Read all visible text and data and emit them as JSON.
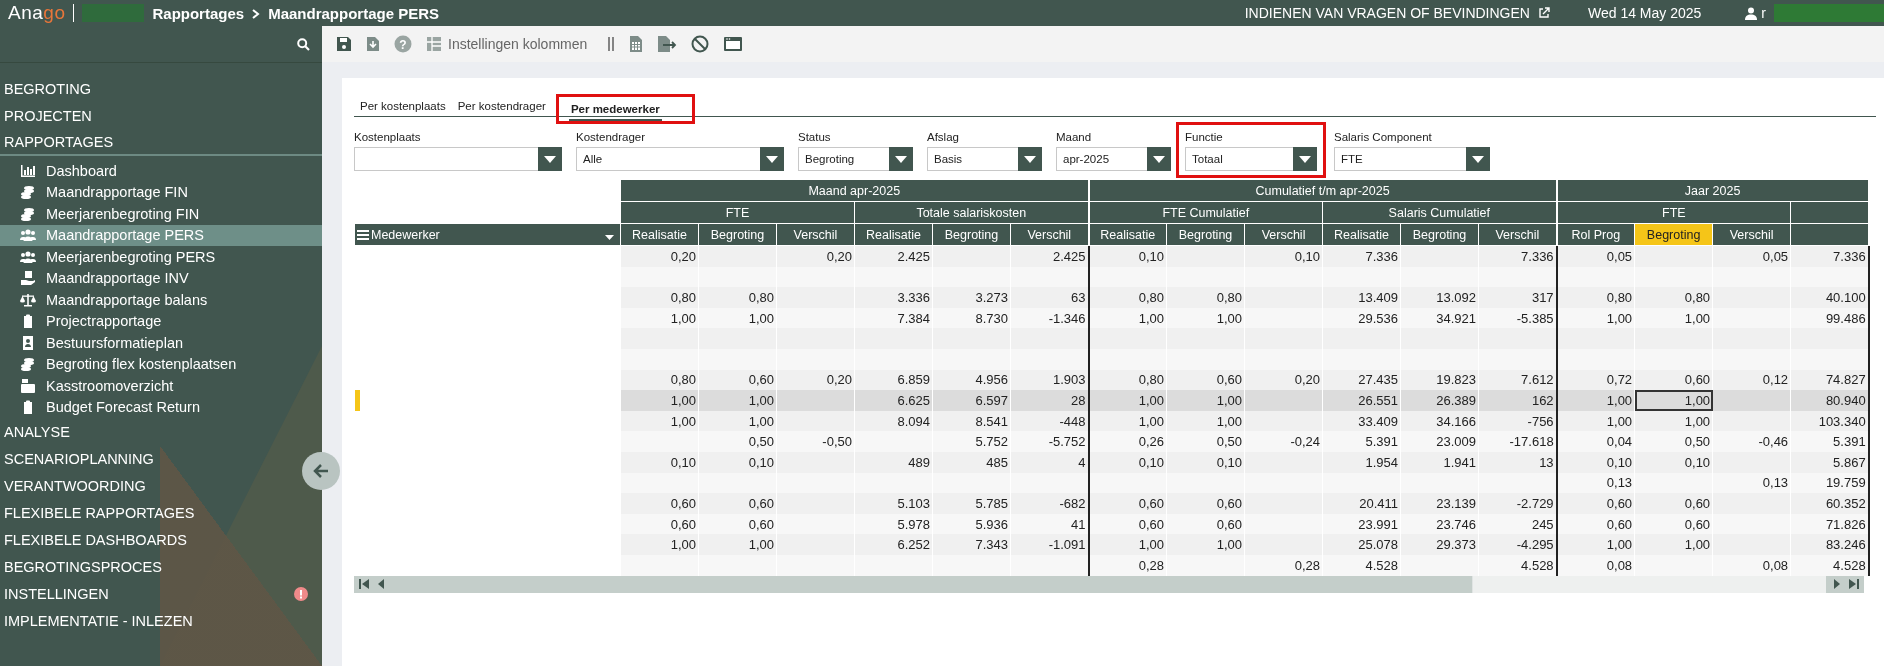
{
  "topbar": {
    "logo_main": "Ana",
    "logo_accent": "go",
    "breadcrumb": [
      "Rapportages",
      "Maandrapportage PERS"
    ],
    "feedback_link": "INDIENEN VAN VRAGEN OF BEVINDINGEN",
    "date": "Wed 14 May 2025",
    "user": "r"
  },
  "toolbar": {
    "help_label": "?",
    "columns_button": "Instellingen kolommen"
  },
  "sidebar": {
    "top_items": [
      {
        "label": "BEGROTING",
        "expanded": false
      },
      {
        "label": "PROJECTEN",
        "expanded": false
      },
      {
        "label": "RAPPORTAGES",
        "expanded": true,
        "children": [
          {
            "label": "Dashboard",
            "selected": false
          },
          {
            "label": "Maandrapportage FIN",
            "selected": false
          },
          {
            "label": "Meerjarenbegroting FIN",
            "selected": false
          },
          {
            "label": "Maandrapportage PERS",
            "selected": true
          },
          {
            "label": "Meerjarenbegroting PERS",
            "selected": false
          },
          {
            "label": "Maandrapportage INV",
            "selected": false
          },
          {
            "label": "Maandrapportage balans",
            "selected": false
          },
          {
            "label": "Projectrapportage",
            "selected": false
          },
          {
            "label": "Bestuursformatieplan",
            "selected": false
          },
          {
            "label": "Begroting flex kostenplaatsen",
            "selected": false
          },
          {
            "label": "Kasstroomoverzicht",
            "selected": false
          },
          {
            "label": "Budget Forecast Return",
            "selected": false
          }
        ]
      },
      {
        "label": "ANALYSE",
        "expanded": false
      },
      {
        "label": "SCENARIOPLANNING",
        "expanded": false
      },
      {
        "label": "VERANTWOORDING",
        "expanded": false
      },
      {
        "label": "FLEXIBELE RAPPORTAGES",
        "expanded": false
      },
      {
        "label": "FLEXIBELE DASHBOARDS",
        "expanded": false
      },
      {
        "label": "BEGROTINGSPROCES",
        "expanded": false
      },
      {
        "label": "INSTELLINGEN",
        "expanded": false,
        "alert": true
      },
      {
        "label": "IMPLEMENTATIE - INLEZEN",
        "expanded": false
      }
    ]
  },
  "tabs": [
    {
      "label": "Per kostenplaats",
      "selected": false
    },
    {
      "label": "Per kostendrager",
      "selected": false
    },
    {
      "label": "Per medewerker",
      "selected": true,
      "annotated": true
    }
  ],
  "filters": [
    {
      "label": "Kostenplaats"
    },
    {
      "label": "Kostendrager",
      "value": "Alle"
    },
    {
      "label": "Status",
      "value": "Begroting"
    },
    {
      "label": "Afslag",
      "value": "Basis"
    },
    {
      "label": "Maand",
      "value": "apr-2025"
    },
    {
      "label": "Functie",
      "value": "Totaal",
      "annotated": true
    },
    {
      "label": "Salaris Component",
      "value": "FTE"
    }
  ],
  "table": {
    "name_column": "Medewerker",
    "groups": [
      {
        "label": "Maand apr-2025",
        "subgroups": [
          {
            "label": "FTE",
            "columns": [
              {
                "label": "Realisatie",
                "selected": false
              },
              {
                "label": "Begroting",
                "selected": false
              },
              {
                "label": "Verschil",
                "selected": false
              }
            ]
          },
          {
            "label": "Totale salariskosten",
            "columns": [
              {
                "label": "Realisatie",
                "selected": false
              },
              {
                "label": "Begroting",
                "selected": false
              },
              {
                "label": "Verschil",
                "selected": false
              }
            ]
          }
        ]
      },
      {
        "label": "Cumulatief t/m apr-2025",
        "subgroups": [
          {
            "label": "FTE Cumulatief",
            "columns": [
              {
                "label": "Realisatie",
                "selected": false
              },
              {
                "label": "Begroting",
                "selected": false
              },
              {
                "label": "Verschil",
                "selected": false
              }
            ]
          },
          {
            "label": "Salaris Cumulatief",
            "columns": [
              {
                "label": "Realisatie",
                "selected": false
              },
              {
                "label": "Begroting",
                "selected": false
              },
              {
                "label": "Verschil",
                "selected": false
              }
            ]
          }
        ]
      },
      {
        "label": "Jaar 2025",
        "subgroups": [
          {
            "label": "FTE",
            "columns": [
              {
                "label": "Rol Prog",
                "selected": false
              },
              {
                "label": "Begroting",
                "selected": true
              },
              {
                "label": "Verschil",
                "selected": false
              }
            ]
          },
          {
            "columns": [
              {
                "selected": false
              }
            ]
          }
        ]
      }
    ],
    "rows": [
      {
        "selected": false,
        "cells": [
          "0,20",
          null,
          "0,20",
          "2.425",
          null,
          "2.425",
          "0,10",
          null,
          "0,10",
          "7.336",
          null,
          "7.336",
          "0,05",
          null,
          "0,05",
          "7.336"
        ]
      },
      {
        "selected": false,
        "cells": [
          null,
          null,
          null,
          null,
          null,
          null,
          null,
          null,
          null,
          null,
          null,
          null,
          null,
          null,
          null,
          null
        ]
      },
      {
        "selected": false,
        "cells": [
          "0,80",
          "0,80",
          null,
          "3.336",
          "3.273",
          "63",
          "0,80",
          "0,80",
          null,
          "13.409",
          "13.092",
          "317",
          "0,80",
          "0,80",
          null,
          "40.100"
        ]
      },
      {
        "selected": false,
        "cells": [
          "1,00",
          "1,00",
          null,
          "7.384",
          "8.730",
          "-1.346",
          "1,00",
          "1,00",
          null,
          "29.536",
          "34.921",
          "-5.385",
          "1,00",
          "1,00",
          null,
          "99.486"
        ]
      },
      {
        "selected": false,
        "cells": [
          null,
          null,
          null,
          null,
          null,
          null,
          null,
          null,
          null,
          null,
          null,
          null,
          null,
          null,
          null,
          null
        ]
      },
      {
        "selected": false,
        "cells": [
          null,
          null,
          null,
          null,
          null,
          null,
          null,
          null,
          null,
          null,
          null,
          null,
          null,
          null,
          null,
          null
        ]
      },
      {
        "selected": false,
        "cells": [
          "0,80",
          "0,60",
          "0,20",
          "6.859",
          "4.956",
          "1.903",
          "0,80",
          "0,60",
          "0,20",
          "27.435",
          "19.823",
          "7.612",
          "0,72",
          "0,60",
          "0,12",
          "74.827"
        ]
      },
      {
        "selected": true,
        "cells": [
          "1,00",
          "1,00",
          null,
          "6.625",
          "6.597",
          "28",
          "1,00",
          "1,00",
          null,
          "26.551",
          "26.389",
          "162",
          "1,00",
          "1,00",
          null,
          "80.940"
        ]
      },
      {
        "selected": false,
        "cells": [
          "1,00",
          "1,00",
          null,
          "8.094",
          "8.541",
          "-448",
          "1,00",
          "1,00",
          null,
          "33.409",
          "34.166",
          "-756",
          "1,00",
          "1,00",
          null,
          "103.340"
        ]
      },
      {
        "selected": false,
        "cells": [
          null,
          "0,50",
          "-0,50",
          null,
          "5.752",
          "-5.752",
          "0,26",
          "0,50",
          "-0,24",
          "5.391",
          "23.009",
          "-17.618",
          "0,04",
          "0,50",
          "-0,46",
          "5.391"
        ]
      },
      {
        "selected": false,
        "cells": [
          "0,10",
          "0,10",
          null,
          "489",
          "485",
          "4",
          "0,10",
          "0,10",
          null,
          "1.954",
          "1.941",
          "13",
          "0,10",
          "0,10",
          null,
          "5.867"
        ]
      },
      {
        "selected": false,
        "cells": [
          null,
          null,
          null,
          null,
          null,
          null,
          null,
          null,
          null,
          null,
          null,
          null,
          "0,13",
          null,
          "0,13",
          "19.759"
        ]
      },
      {
        "selected": false,
        "cells": [
          "0,60",
          "0,60",
          null,
          "5.103",
          "5.785",
          "-682",
          "0,60",
          "0,60",
          null,
          "20.411",
          "23.139",
          "-2.729",
          "0,60",
          "0,60",
          null,
          "60.352"
        ]
      },
      {
        "selected": false,
        "cells": [
          "0,60",
          "0,60",
          null,
          "5.978",
          "5.936",
          "41",
          "0,60",
          "0,60",
          null,
          "23.991",
          "23.746",
          "245",
          "0,60",
          "0,60",
          null,
          "71.826"
        ]
      },
      {
        "selected": false,
        "cells": [
          "1,00",
          "1,00",
          null,
          "6.252",
          "7.343",
          "-1.091",
          "1,00",
          "1,00",
          null,
          "25.078",
          "29.373",
          "-4.295",
          "1,00",
          "1,00",
          null,
          "83.246"
        ]
      },
      {
        "selected": false,
        "cells": [
          null,
          null,
          null,
          null,
          null,
          null,
          "0,28",
          null,
          "0,28",
          "4.528",
          null,
          "4.528",
          "0,08",
          null,
          "0,08",
          "4.528"
        ]
      }
    ]
  }
}
